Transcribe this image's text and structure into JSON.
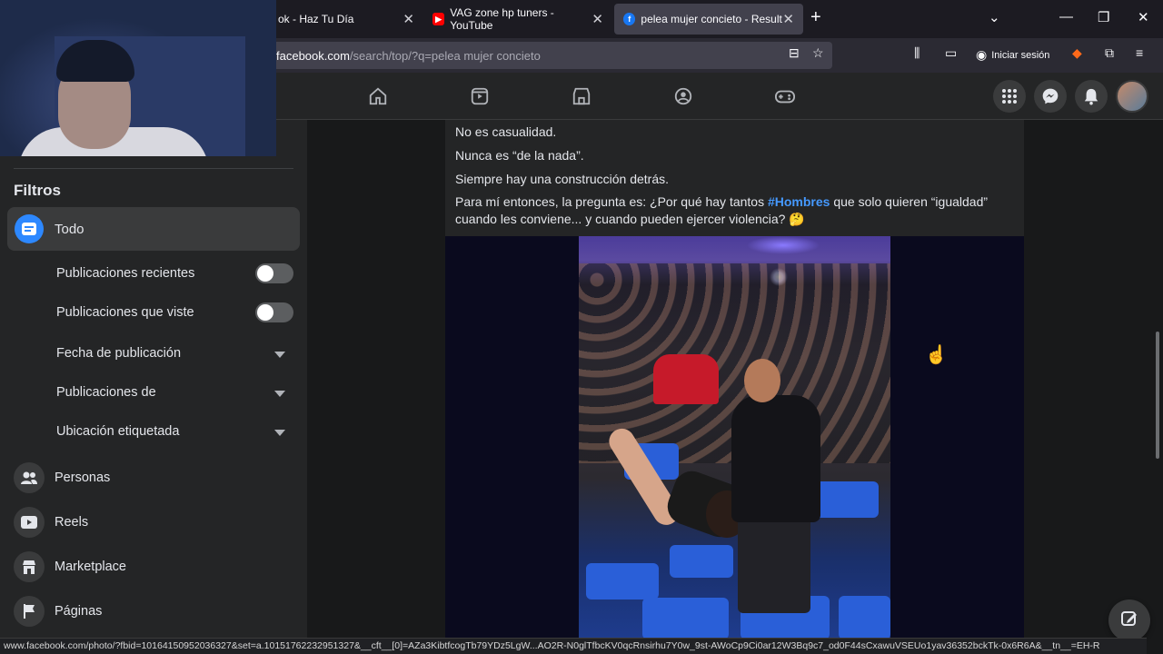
{
  "browser": {
    "tabs": [
      {
        "title": "ok - Haz Tu Día",
        "active": false
      },
      {
        "title": "VAG zone hp tuners - YouTube",
        "active": false
      },
      {
        "title": "pelea mujer concieto - Resultad",
        "active": true
      }
    ],
    "new_tab": "+",
    "url_host": "facebook.com",
    "url_path": "/search/top/?q=pelea mujer concieto",
    "sign_in_label": "Iniciar sesión",
    "status_url": "www.facebook.com/photo/?fbid=10164150952036327&set=a.10151762232951327&__cft__[0]=AZa3KibtfcogTb79YDz5LgW...AO2R-N0glTfbcKV0qcRnsirhu7Y0w_9st-AWoCp9Ci0ar12W3Bq9c7_od0F44sCxawuVSEUo1yav36352bckTk-0x6R6A&__tn__=EH-R"
  },
  "sidebar": {
    "title": "Filtros",
    "selected": "Todo",
    "toggles": [
      {
        "label": "Publicaciones recientes",
        "on": false
      },
      {
        "label": "Publicaciones que viste",
        "on": false
      }
    ],
    "dropdowns": [
      {
        "label": "Fecha de publicación"
      },
      {
        "label": "Publicaciones de"
      },
      {
        "label": "Ubicación etiquetada"
      }
    ],
    "items": [
      {
        "label": "Personas",
        "icon": "people-icon"
      },
      {
        "label": "Reels",
        "icon": "reels-play-icon"
      },
      {
        "label": "Marketplace",
        "icon": "marketplace-store-icon"
      },
      {
        "label": "Páginas",
        "icon": "flag-icon"
      }
    ]
  },
  "post": {
    "line1": "No es casualidad.",
    "line2": "Nunca es “de la nada”.",
    "line3": "Siempre hay una construcción detrás.",
    "line4_before": "Para mí entonces, la pregunta es: ¿Por qué hay tantos ",
    "hashtag": "#Hombres",
    "line4_after": " que solo quieren “igualdad” cuando les conviene... y cuando pueden ejercer violencia? 🤔"
  },
  "colors": {
    "accent": "#2d88ff",
    "hashtag": "#4599ff",
    "fb_background": "#18191a",
    "fb_surface": "#242526"
  }
}
